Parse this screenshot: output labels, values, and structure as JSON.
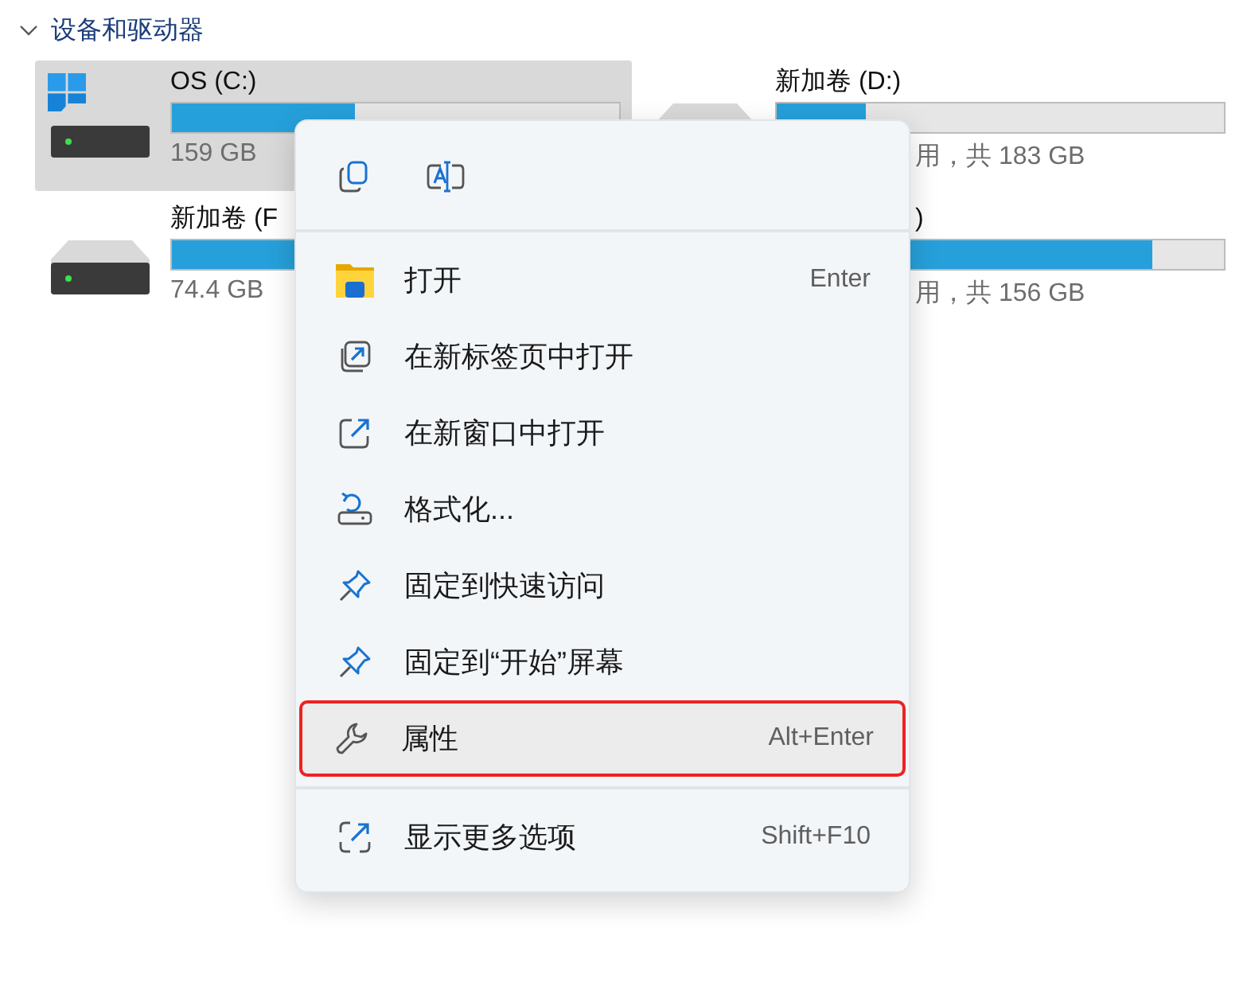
{
  "section": {
    "title": "设备和驱动器",
    "expanded": true
  },
  "drives": [
    {
      "name": "OS (C:)",
      "level": 0.41,
      "caption": "159 GB",
      "selected": true,
      "system": true,
      "covered": false
    },
    {
      "name": "新加卷 (D:)",
      "level": 0.2,
      "caption": "用，共 183 GB",
      "selected": false,
      "system": false,
      "covered": true
    },
    {
      "name": "新加卷 (F",
      "level": 0.5,
      "caption": "74.4 GB",
      "selected": false,
      "system": false,
      "covered": false
    },
    {
      "name": ")",
      "level": 0.84,
      "caption": "用，共 156 GB",
      "selected": false,
      "system": false,
      "covered": true
    }
  ],
  "menu": {
    "groups": [
      [
        {
          "label": "打开",
          "shortcut": "Enter",
          "selected": false
        },
        {
          "label": "在新标签页中打开",
          "selected": false
        },
        {
          "label": "在新窗口中打开",
          "selected": false
        },
        {
          "label": "格式化...",
          "selected": false
        },
        {
          "label": "固定到快速访问",
          "selected": false
        },
        {
          "label": "固定到“开始”屏幕",
          "selected": false
        },
        {
          "label": "属性",
          "shortcut": "Alt+Enter",
          "selected": true
        }
      ],
      [
        {
          "label": "显示更多选项",
          "shortcut": "Shift+F10",
          "selected": false
        }
      ]
    ]
  }
}
